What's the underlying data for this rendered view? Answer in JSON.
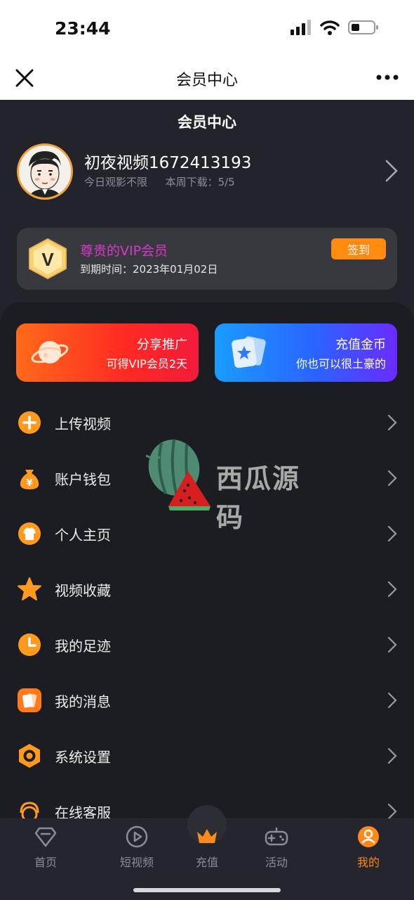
{
  "status_bar": {
    "time": "23:44"
  },
  "navbar": {
    "title": "会员中心"
  },
  "page": {
    "title": "会员中心"
  },
  "profile": {
    "name": "初夜视频1672413193",
    "today_text": "今日观影不限",
    "download_text": "本周下载：5/5"
  },
  "vip": {
    "badge_letter": "V",
    "title": "尊贵的VIP会员",
    "expire": "到期时间：2023年01月02日",
    "sign_label": "签到"
  },
  "promos": [
    {
      "title": "分享推广",
      "subtitle": "可得VIP会员2天"
    },
    {
      "title": "充值金币",
      "subtitle": "你也可以很土豪的"
    }
  ],
  "menu": [
    {
      "label": "上传视频",
      "icon": "plus-icon"
    },
    {
      "label": "账户钱包",
      "icon": "money-bag-icon"
    },
    {
      "label": "个人主页",
      "icon": "shirt-icon"
    },
    {
      "label": "视频收藏",
      "icon": "star-icon"
    },
    {
      "label": "我的足迹",
      "icon": "clock-icon"
    },
    {
      "label": "我的消息",
      "icon": "message-cards-icon"
    },
    {
      "label": "系统设置",
      "icon": "settings-hex-icon"
    },
    {
      "label": "在线客服",
      "icon": "support-icon"
    }
  ],
  "watermark": {
    "text": "西瓜源码"
  },
  "tabbar": {
    "items": [
      {
        "label": "首页",
        "icon": "diamond-icon"
      },
      {
        "label": "短视频",
        "icon": "play-icon"
      },
      {
        "label": "充值",
        "icon": "crown-icon"
      },
      {
        "label": "活动",
        "icon": "gamepad-icon"
      },
      {
        "label": "我的",
        "icon": "user-icon"
      }
    ],
    "active": "我的"
  },
  "colors": {
    "accent": "#ff8a0f",
    "vip_title": "#d63ac8",
    "background": "#1f1f26"
  }
}
